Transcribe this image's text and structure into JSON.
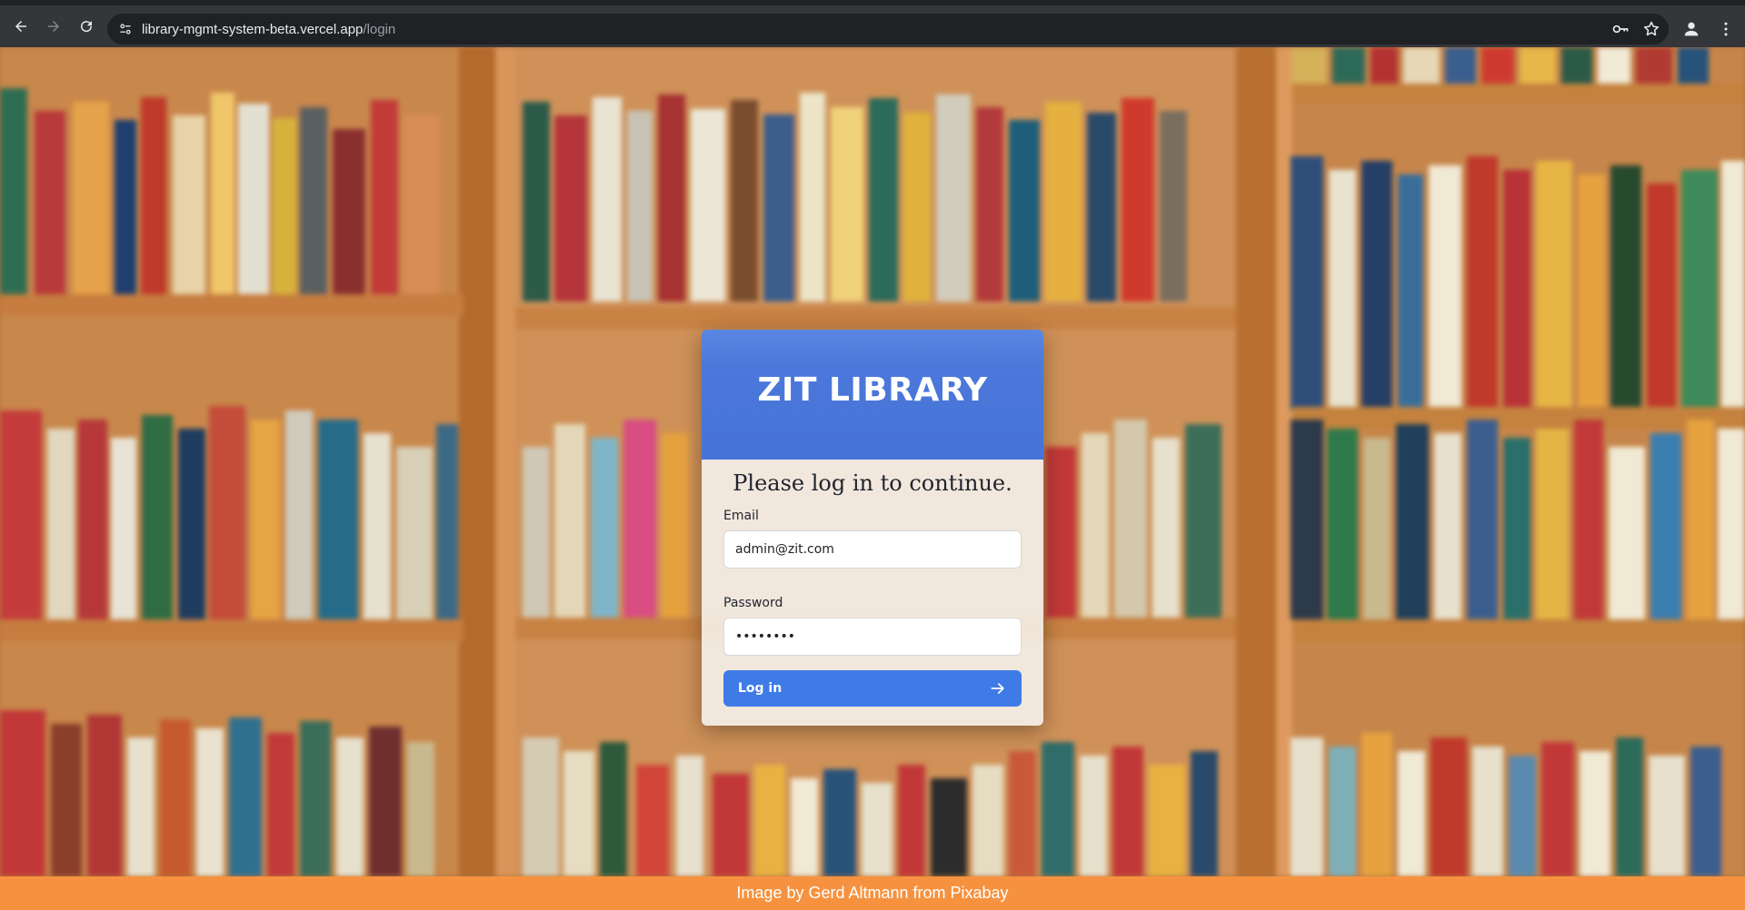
{
  "browser": {
    "url_host": "library-mgmt-system-beta.vercel.app",
    "url_path": "/login"
  },
  "login": {
    "brand": "ZIT LIBRARY",
    "subtitle": "Please log in to continue.",
    "email_label": "Email",
    "email_value": "admin@zit.com",
    "password_label": "Password",
    "password_value": "••••••••",
    "button_label": "Log in"
  },
  "footer": {
    "credit": "Image by Gerd Altmann from Pixabay"
  },
  "colors": {
    "header_blue": "#4c78db",
    "button_blue": "#3f7be6",
    "footer_orange": "#f6923f"
  },
  "icons": [
    "back-icon",
    "forward-icon",
    "reload-icon",
    "site-info-icon",
    "password-key-icon",
    "bookmark-star-icon",
    "profile-icon",
    "menu-icon",
    "arrow-right-icon"
  ]
}
